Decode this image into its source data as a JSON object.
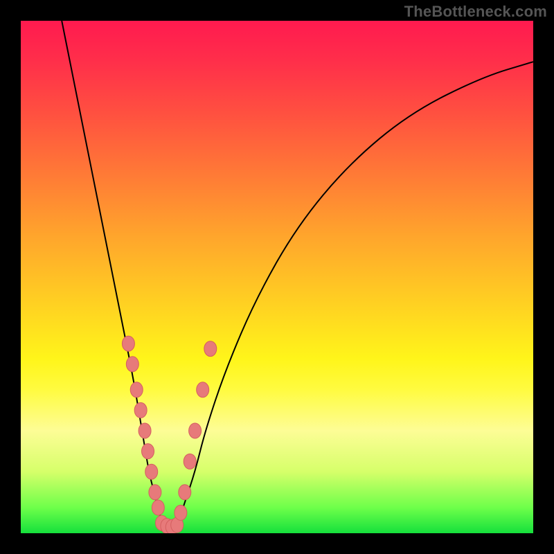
{
  "watermark": "TheBottleneck.com",
  "domain_note": "Bottleneck-style V-curve with rainbow gradient background",
  "chart_data": {
    "type": "line",
    "title": "",
    "xlabel": "",
    "ylabel": "",
    "xlim": [
      0,
      100
    ],
    "ylim": [
      0,
      100
    ],
    "series": [
      {
        "name": "left-branch",
        "x": [
          8,
          10,
          12,
          14,
          16,
          18,
          20,
          22,
          24,
          25,
          26,
          27,
          28
        ],
        "y": [
          100,
          90,
          80,
          70,
          60,
          50,
          40,
          30,
          18,
          12,
          8,
          4,
          1
        ]
      },
      {
        "name": "right-branch",
        "x": [
          30,
          31,
          32,
          34,
          36,
          40,
          46,
          54,
          64,
          76,
          90,
          100
        ],
        "y": [
          1,
          3,
          6,
          12,
          20,
          32,
          46,
          60,
          72,
          82,
          89,
          92
        ]
      }
    ],
    "beads_left": [
      {
        "x": 21.0,
        "y": 37
      },
      {
        "x": 21.8,
        "y": 33
      },
      {
        "x": 22.6,
        "y": 28
      },
      {
        "x": 23.4,
        "y": 24
      },
      {
        "x": 24.2,
        "y": 20
      },
      {
        "x": 24.8,
        "y": 16
      },
      {
        "x": 25.5,
        "y": 12
      },
      {
        "x": 26.2,
        "y": 8
      },
      {
        "x": 26.8,
        "y": 5
      }
    ],
    "beads_bottom": [
      {
        "x": 27.5,
        "y": 2.0
      },
      {
        "x": 28.5,
        "y": 1.4
      },
      {
        "x": 29.5,
        "y": 1.2
      },
      {
        "x": 30.5,
        "y": 1.6
      }
    ],
    "beads_right": [
      {
        "x": 31.2,
        "y": 4
      },
      {
        "x": 32.0,
        "y": 8
      },
      {
        "x": 33.0,
        "y": 14
      },
      {
        "x": 34.0,
        "y": 20
      },
      {
        "x": 35.5,
        "y": 28
      },
      {
        "x": 37.0,
        "y": 36
      }
    ]
  }
}
